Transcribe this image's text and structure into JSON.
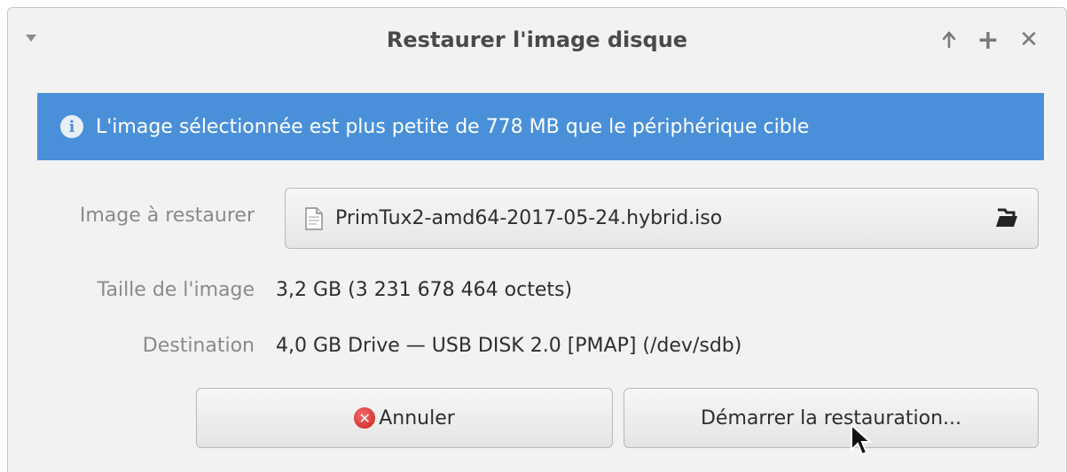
{
  "window": {
    "title": "Restaurer l'image disque",
    "controls": {
      "up": "↑",
      "maximize": "+",
      "close": "✕"
    }
  },
  "info_bar": {
    "icon": "info-icon",
    "message": "L'image sélectionnée est plus petite de 778 MB que le périphérique cible",
    "color": "#4a90d9"
  },
  "form": {
    "image_label": "Image à restaurer",
    "image_file": "PrimTux2-amd64-2017-05-24.hybrid.iso",
    "size_label": "Taille de l'image",
    "size_value": "3,2 GB (3 231 678 464 octets)",
    "destination_label": "Destination",
    "destination_value": "4,0 GB Drive — USB DISK 2.0 [PMAP] (/dev/sdb)"
  },
  "actions": {
    "cancel_label": "Annuler",
    "start_label": "Démarrer la restauration..."
  }
}
